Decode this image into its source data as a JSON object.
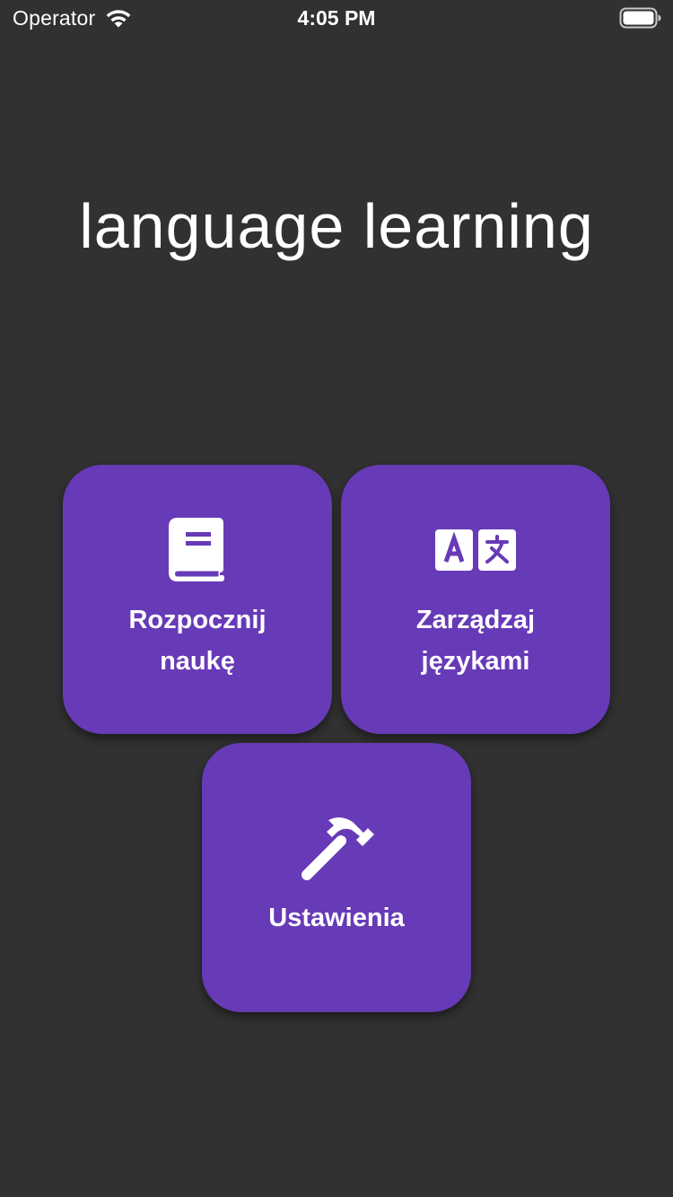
{
  "status_bar": {
    "carrier": "Operator",
    "time": "4:05 PM"
  },
  "app_title": "language learning",
  "menu": {
    "start_learning": {
      "line1": "Rozpocznij",
      "line2": "naukę",
      "icon": "book-icon"
    },
    "manage_languages": {
      "line1": "Zarządzaj",
      "line2": "językami",
      "icon": "translate-icon"
    },
    "settings": {
      "label": "Ustawienia",
      "icon": "hammer-icon"
    }
  },
  "colors": {
    "background": "#313131",
    "tile": "#673ab7",
    "text": "#ffffff"
  }
}
